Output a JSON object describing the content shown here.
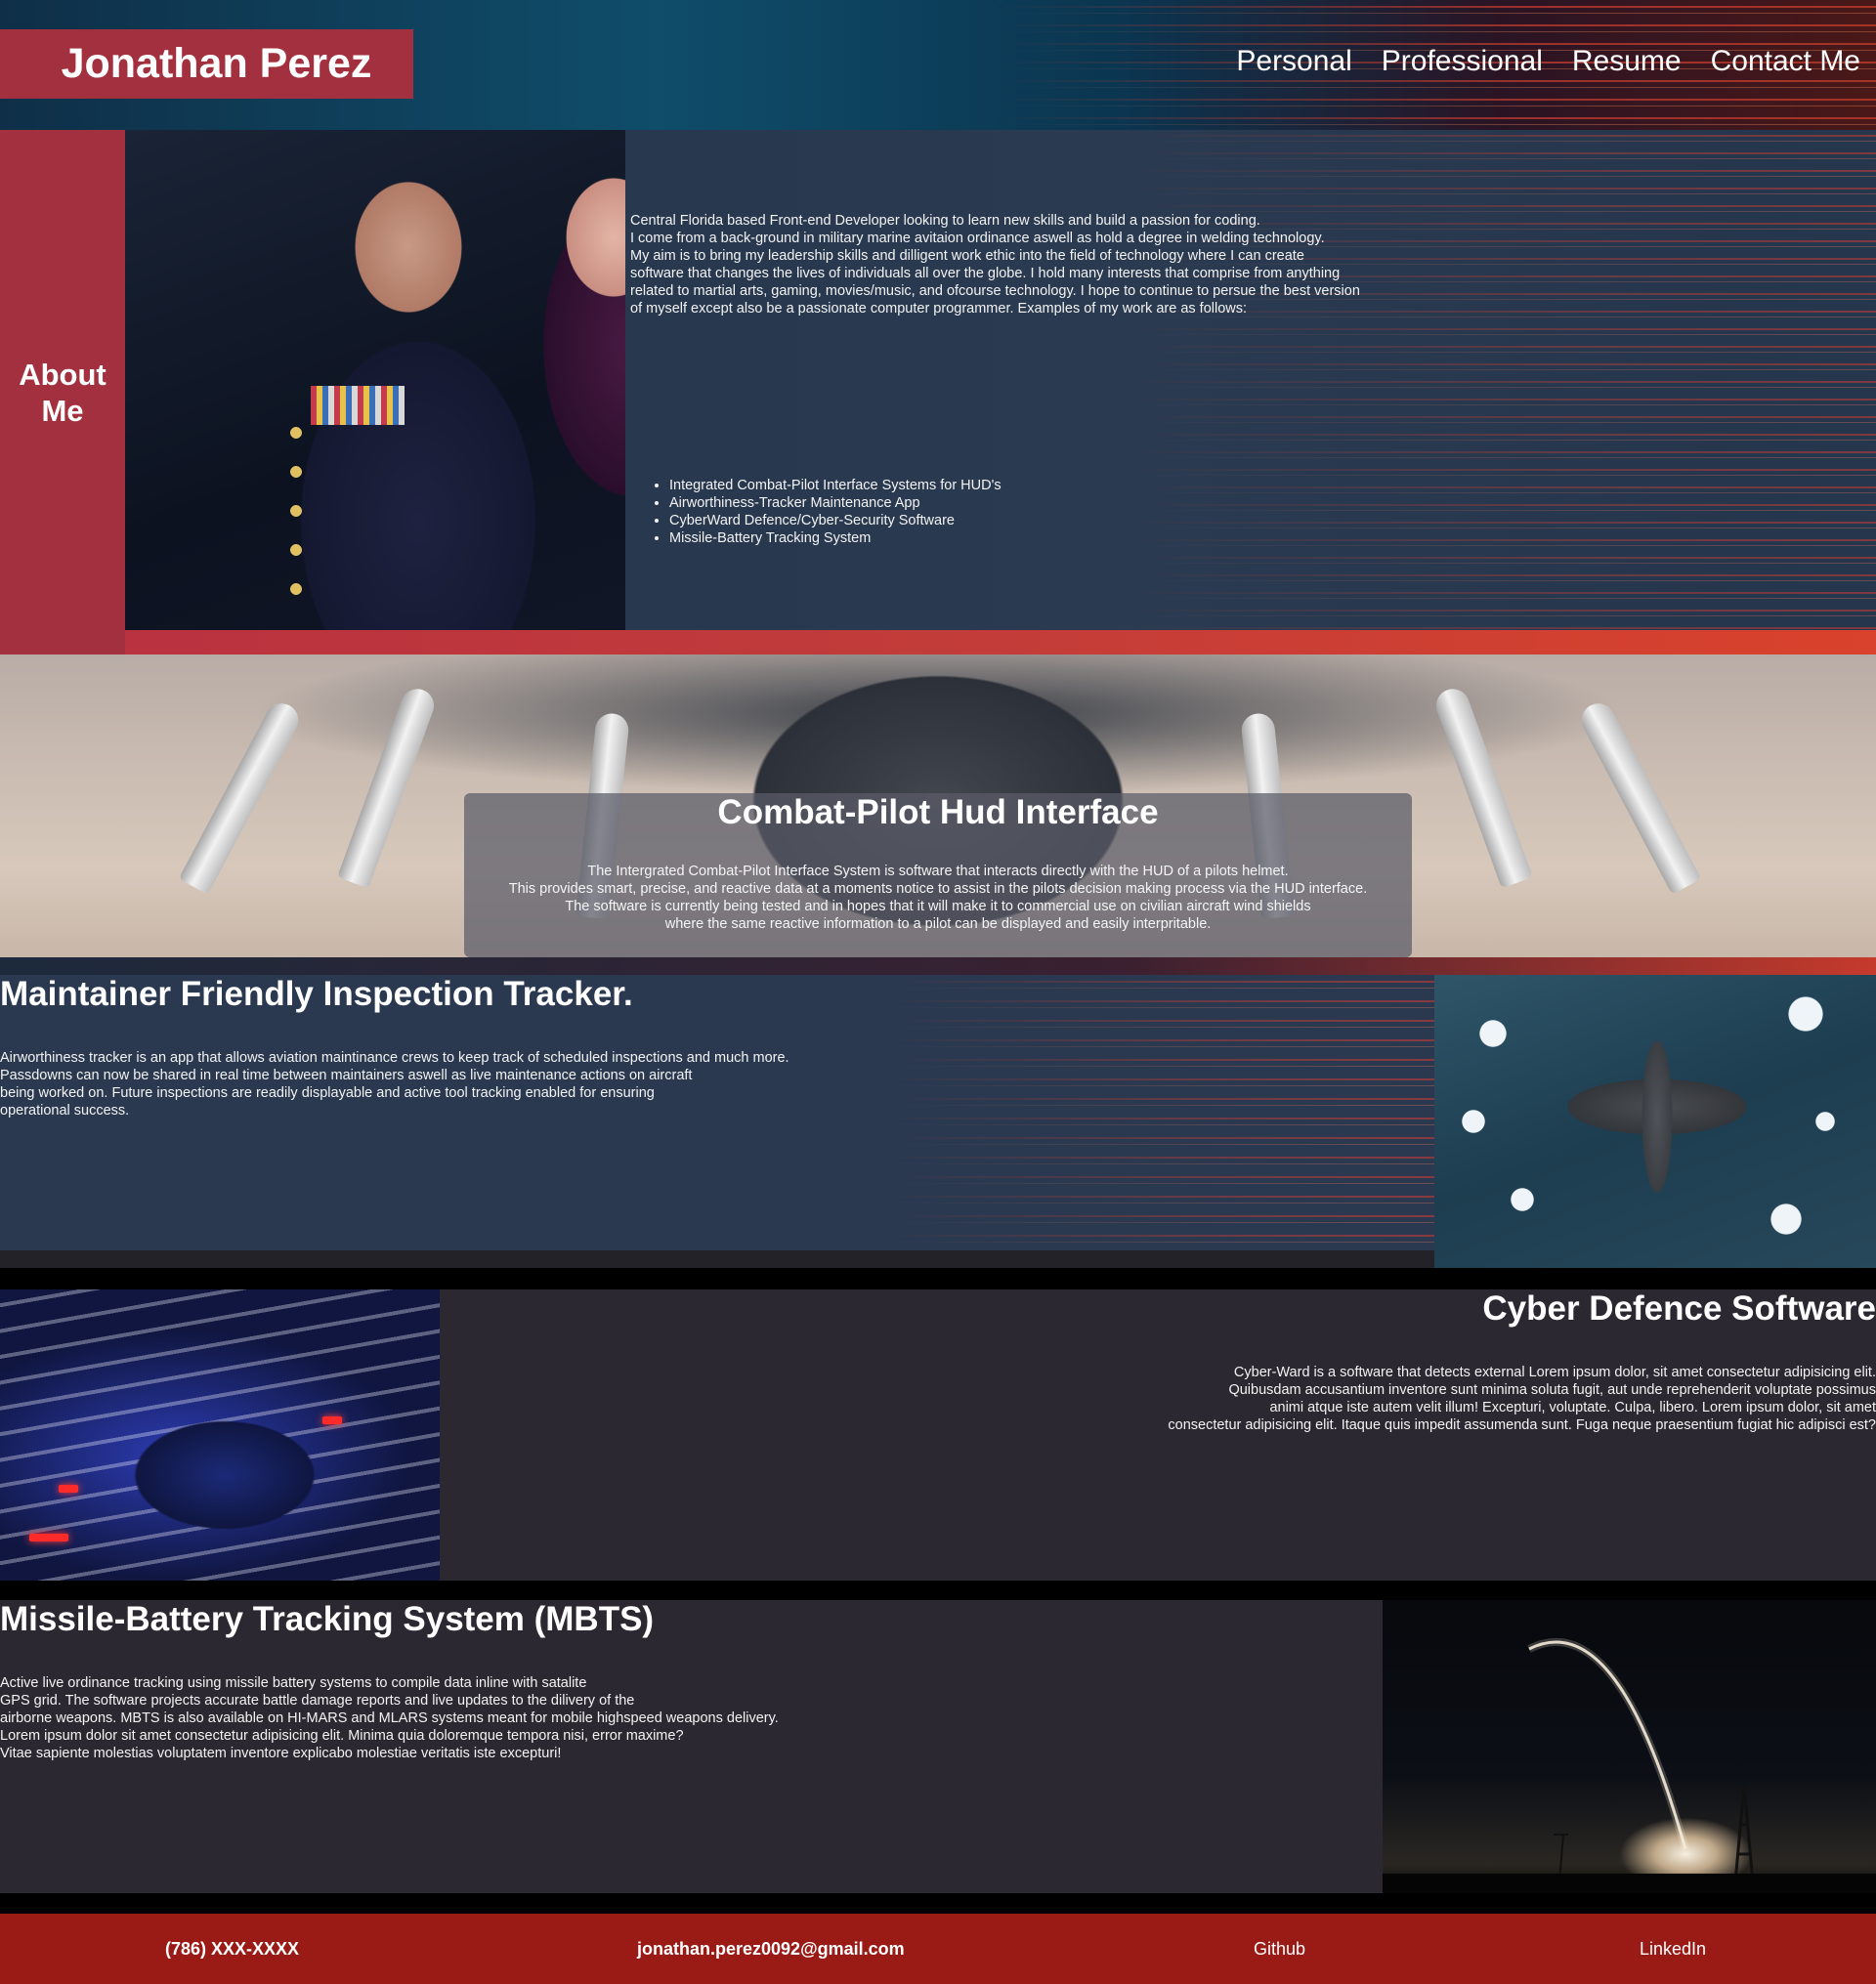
{
  "header": {
    "brand": "Jonathan Perez",
    "nav": [
      "Personal",
      "Professional",
      "Resume",
      "Contact Me"
    ]
  },
  "about": {
    "label": "About Me",
    "paragraph_lines": [
      "Central Florida based Front-end Developer looking to learn new skills and build a passion for coding.",
      "I come from a back-ground in military marine avitaion ordinance aswell as hold a degree in welding technology.",
      "My aim is to bring my leadership skills and dilligent work ethic into the field of technology where I can create",
      "software that changes the lives of individuals all over the globe. I hold many interests that comprise from anything",
      "related to martial arts, gaming, movies/music, and ofcourse technology. I hope to continue to persue the best version",
      "of myself except also be a passionate computer programmer. Examples of my work are as follows:"
    ],
    "projects": [
      "Integrated Combat-Pilot Interface Systems for HUD's",
      "Airworthiness-Tracker Maintenance App",
      "CyberWard Defence/Cyber-Security Software",
      "Missile-Battery Tracking System"
    ]
  },
  "combat": {
    "title": "Combat-Pilot Hud Interface",
    "lines": [
      "The Intergrated Combat-Pilot Interface System is software that interacts directly with the HUD of a pilots helmet.",
      "This provides smart, precise, and reactive data at a moments notice to assist in the pilots decision making process via the HUD interface.",
      "The software is currently being tested and in hopes that it will make it to commercial use on civilian aircraft wind shields",
      "where the same reactive information to a pilot can be displayed and easily interpritable."
    ]
  },
  "maintainer": {
    "title": "Maintainer Friendly Inspection Tracker.",
    "lines": [
      "Airworthiness tracker is an app that allows aviation maintinance crews to keep track of scheduled inspections and much more.",
      "Passdowns can now be shared in real time between maintainers aswell as live maintenance actions on aircraft",
      "being worked on. Future inspections are readily displayable and active tool tracking enabled for ensuring",
      "operational success."
    ]
  },
  "cyber": {
    "title": "Cyber Defence Software",
    "lines": [
      "Cyber-Ward is a software that detects external Lorem ipsum dolor, sit amet consectetur adipisicing elit.",
      "Quibusdam accusantium inventore sunt minima soluta fugit, aut unde reprehenderit voluptate possimus",
      "animi atque iste autem velit illum! Excepturi, voluptate. Culpa, libero. Lorem ipsum dolor, sit amet",
      "consectetur adipisicing elit. Itaque quis impedit assumenda sunt. Fuga neque praesentium fugiat hic adipisci est?"
    ]
  },
  "mbts": {
    "title": "Missile-Battery Tracking System (MBTS)",
    "lines": [
      "Active live ordinance tracking using missile battery systems to compile data inline with satalite",
      "GPS grid. The software projects accurate battle damage reports and live updates to the dilivery of the",
      "airborne weapons. MBTS is also available on HI-MARS and MLARS systems meant for mobile highspeed weapons delivery.",
      "Lorem ipsum dolor sit amet consectetur adipisicing elit. Minima quia doloremque tempora nisi, error maxime?",
      "Vitae sapiente molestias voluptatem inventore explicabo molestiae veritatis iste excepturi!"
    ]
  },
  "footer": {
    "phone": "(786) XXX-XXXX",
    "email": "jonathan.perez0092@gmail.com",
    "github": "Github",
    "linkedin": "LinkedIn"
  },
  "colors": {
    "accent": "#a3303e",
    "footer": "#9a1a15",
    "panel": "#2b2831"
  }
}
